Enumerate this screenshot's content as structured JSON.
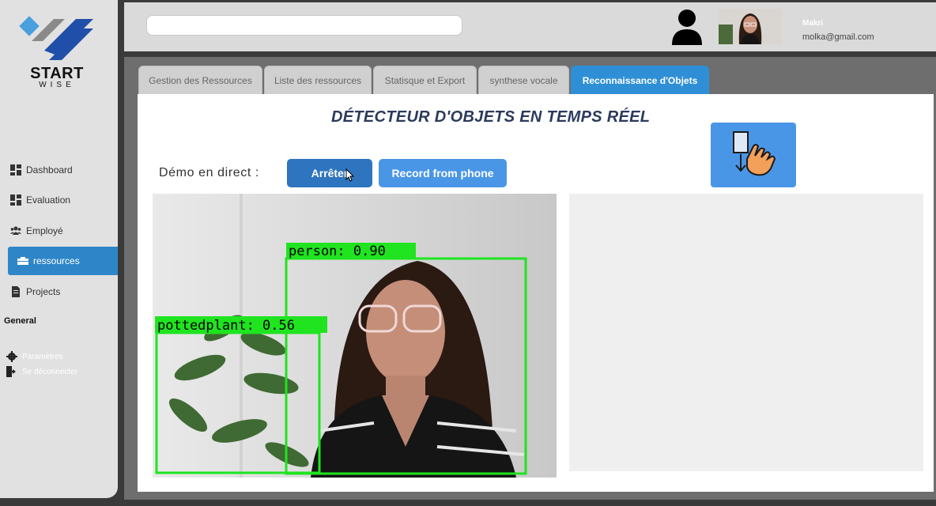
{
  "brand": {
    "line1": "START",
    "line2": "WISE",
    "colors": {
      "blue": "#1f4fa8",
      "gray": "#8a8a8a",
      "light": "#4aa0dd"
    }
  },
  "sidebar": {
    "items": [
      {
        "label": "Dashboard",
        "icon": "dashboard-icon"
      },
      {
        "label": "Evaluation",
        "icon": "dashboard-icon"
      },
      {
        "label": "Employé",
        "icon": "users-icon"
      },
      {
        "label": "ressources",
        "icon": "toolbox-icon",
        "active": true
      },
      {
        "label": "Projects",
        "icon": "file-icon"
      }
    ],
    "section_title": "General",
    "settings_label": "Paramètres",
    "logout_label": "Se déconnecter"
  },
  "header": {
    "search_value": "",
    "user_name": "Makri",
    "user_email": "molka@gmail.com"
  },
  "tabs": [
    {
      "label": "Gestion des Ressources"
    },
    {
      "label": "Liste des ressources"
    },
    {
      "label": "Statisque et Export"
    },
    {
      "label": "synthese vocale"
    },
    {
      "label": "Reconnaissance d'Objets",
      "active": true
    }
  ],
  "main": {
    "title": "DÉTECTEUR D'OBJETS EN TEMPS RÉEL",
    "demo_label": "Démo en direct :",
    "stop_label": "Arrêter",
    "record_label": "Record from phone"
  },
  "detections": [
    {
      "label": "person: 0.90"
    },
    {
      "label": "pottedplant: 0.56"
    }
  ],
  "colors": {
    "accent": "#2f8fd6",
    "box": "#1fe41f"
  }
}
